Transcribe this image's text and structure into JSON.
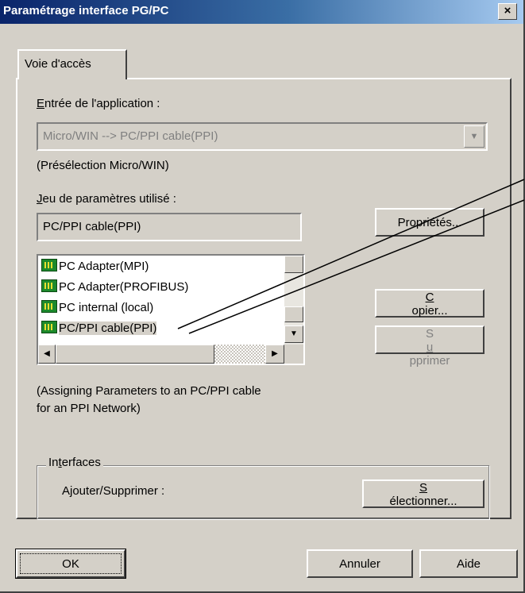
{
  "window": {
    "title": "Paramétrage interface PG/PC",
    "close_glyph": "×"
  },
  "tabs": [
    {
      "label": "Voie d'accès"
    }
  ],
  "app_entry": {
    "label_first": "E",
    "label_rest": "ntrée de l'application :",
    "value": "Micro/WIN      --> PC/PPI cable(PPI)",
    "preselection": "(Présélection Micro/WIN)"
  },
  "param_set": {
    "label_first": "J",
    "label_rest": "eu de paramètres utilisé :",
    "value": "PC/PPI cable(PPI)",
    "properties_button": "Propriétés..."
  },
  "param_list": {
    "items": [
      {
        "label": "PC Adapter(MPI)",
        "icon": "network-adapter-icon"
      },
      {
        "label": "PC Adapter(PROFIBUS)",
        "icon": "network-adapter-icon"
      },
      {
        "label": "PC internal (local)",
        "icon": "network-adapter-icon"
      },
      {
        "label": "PC/PPI cable(PPI)",
        "icon": "network-adapter-icon",
        "selected": true
      }
    ]
  },
  "description": {
    "line1": "(Assigning Parameters to an PC/PPI cable",
    "line2": "for an PPI Network)"
  },
  "side_buttons": {
    "copy_first": "C",
    "copy_rest": "opier...",
    "delete_before": "S",
    "delete_u": "u",
    "delete_after": "pprimer"
  },
  "interfaces": {
    "group_before": "In",
    "group_u": "t",
    "group_after": "erfaces",
    "add_remove_label": "Ajouter/Supprimer :",
    "select_u": "S",
    "select_rest": "électionner..."
  },
  "footer": {
    "ok": "OK",
    "cancel": "Annuler",
    "help": "Aide"
  },
  "colors": {
    "titlebar": "#0a246a",
    "face": "#d4d0c8",
    "disabled_text": "#808080"
  }
}
